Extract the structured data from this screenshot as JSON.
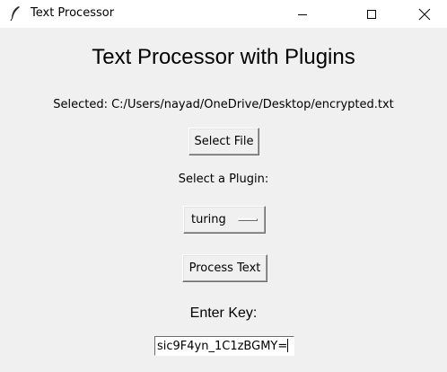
{
  "window": {
    "title": "Text Processor"
  },
  "icons": {
    "app": "feather-icon",
    "minimize": "minimize-icon",
    "maximize": "maximize-icon",
    "close": "close-icon"
  },
  "main": {
    "heading": "Text Processor with Plugins",
    "selected_file_text": "Selected: C:/Users/nayad/OneDrive/Desktop/encrypted.txt",
    "select_file_button": "Select File",
    "plugin_label": "Select a Plugin:",
    "plugin_selected": "turing",
    "process_button": "Process Text",
    "key_label": "Enter Key:",
    "key_value": "sic9F4yn_1C1zBGMY="
  }
}
